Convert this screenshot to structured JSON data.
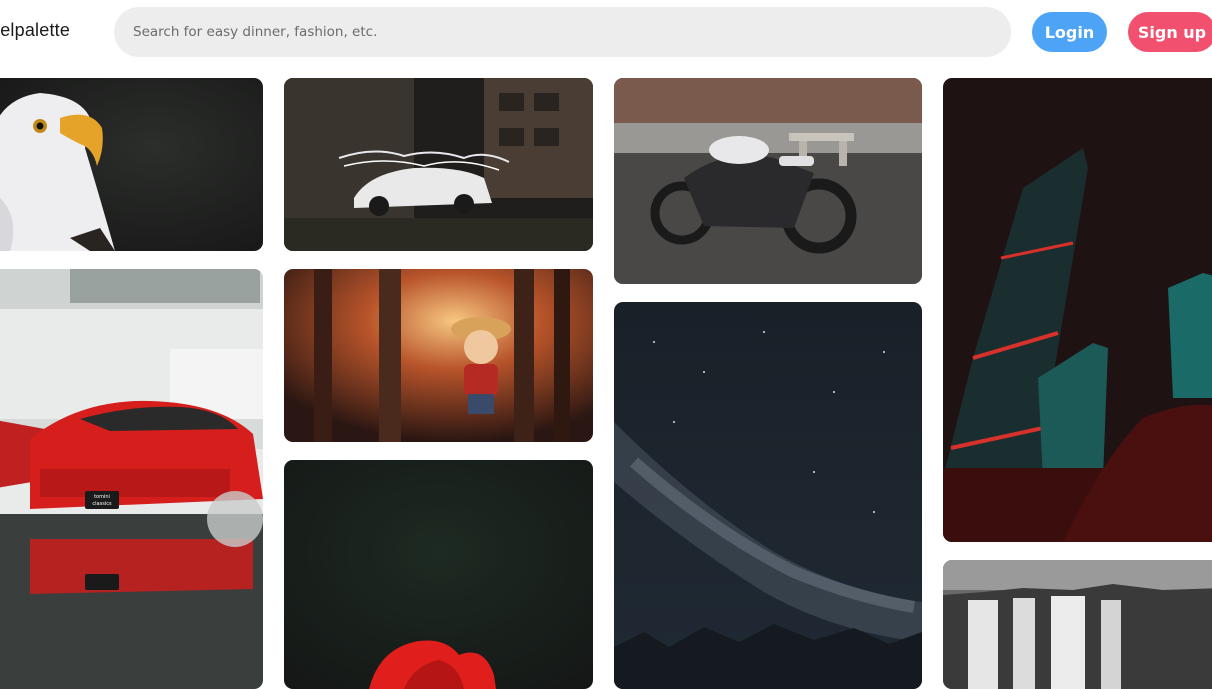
{
  "header": {
    "logo_text": "xelpalette",
    "search": {
      "placeholder": "Search for easy dinner, fashion, etc.",
      "value": ""
    },
    "login_label": "Login",
    "signup_label": "Sign up"
  },
  "colors": {
    "login": "#4da3f5",
    "signup": "#f2506f",
    "search_bg": "#ededed"
  },
  "gallery": {
    "tiles": [
      {
        "id": "eagle"
      },
      {
        "id": "white-car-light-painting"
      },
      {
        "id": "motorcycle"
      },
      {
        "id": "city-towers-night"
      },
      {
        "id": "red-sports-car"
      },
      {
        "id": "anime-forest-boy"
      },
      {
        "id": "milky-way-night-sky"
      },
      {
        "id": "red-flower-dark"
      },
      {
        "id": "waterfall"
      }
    ],
    "plates": {
      "top_line": "tomini",
      "bottom_line": "classics"
    }
  }
}
